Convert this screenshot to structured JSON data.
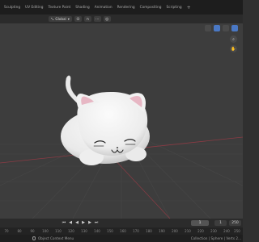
{
  "workspace_tabs": [
    "Sculpting",
    "UV Editing",
    "Texture Paint",
    "Shading",
    "Animation",
    "Rendering",
    "Compositing",
    "Scripting"
  ],
  "add_tab_label": "+",
  "viewport_header": {
    "orientation_label": "Global"
  },
  "timeline": {
    "current_frame": "1",
    "start_frame": "1",
    "end_frame": "250"
  },
  "ruler_ticks": [
    "70",
    "80",
    "90",
    "100",
    "110",
    "120",
    "130",
    "140",
    "150",
    "160",
    "170",
    "180",
    "190",
    "200",
    "210",
    "220",
    "230",
    "240",
    "250"
  ],
  "statusbar": {
    "hint": "Object Context Menu",
    "stats": "Collection | Sphere | Verts 2..."
  },
  "colors": {
    "viewport_bg": "#3d3d3d",
    "grid": "#474747",
    "x_axis": "#8b3b44",
    "y_axis": "#6f8b2c",
    "mesh": "#efefef",
    "ear_inner": "#e7b7c4",
    "accent": "#4a78c4"
  },
  "icons": [
    "mouse-icon",
    "play-icon",
    "jump-start-icon",
    "jump-end-icon",
    "keyframe-prev-icon",
    "keyframe-next-icon",
    "gizmo-icon",
    "overlay-icon",
    "xray-icon",
    "shading-solid-icon",
    "zoom-icon",
    "pan-icon"
  ]
}
